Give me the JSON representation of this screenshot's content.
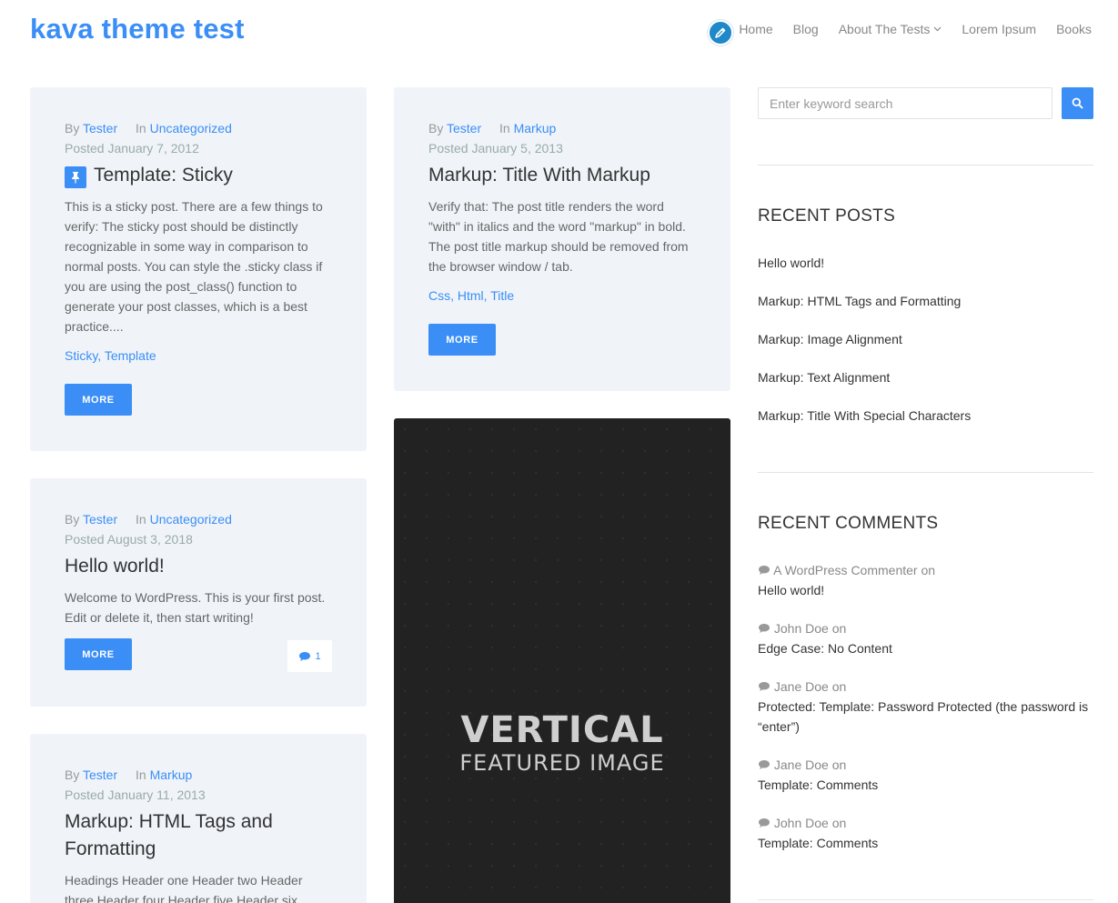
{
  "site": {
    "title": "kava theme test"
  },
  "nav": {
    "items": [
      "Home",
      "Blog",
      "About The Tests",
      "Lorem Ipsum",
      "Books"
    ]
  },
  "posts": [
    {
      "by_label": "By",
      "author": "Tester",
      "in_label": "In",
      "category": "Uncategorized",
      "date": "Posted January 7, 2012",
      "title": "Template: Sticky",
      "excerpt": "This is a sticky post. There are a few things to verify: The sticky post should be distinctly recognizable in some way in comparison to normal posts. You can style the .sticky class if you are using the post_class() function to generate your post classes, which is a best practice....",
      "tags": "Sticky, Template",
      "more": "MORE"
    },
    {
      "by_label": "By",
      "author": "Tester",
      "in_label": "In",
      "category": "Markup",
      "date": "Posted January 5, 2013",
      "title": "Markup: Title With Markup",
      "excerpt": "Verify that: The post title renders the word \"with\" in italics and the word \"markup\" in bold. The post title markup should be removed from the browser window / tab.",
      "tags": "Css, Html, Title",
      "more": "MORE"
    },
    {
      "by_label": "By",
      "author": "Tester",
      "in_label": "In",
      "category": "Uncategorized",
      "date": "Posted August 3, 2018",
      "title": "Hello world!",
      "excerpt": "Welcome to WordPress. This is your first post. Edit or delete it, then start writing!",
      "more": "MORE",
      "comments": "1"
    },
    {
      "by_label": "By",
      "author": "Tester",
      "in_label": "In",
      "category": "Markup",
      "date": "Posted January 11, 2013",
      "title": "Markup: HTML Tags and Formatting",
      "excerpt": "Headings Header one Header two Header three Header four Header five Header six Blockquotes"
    }
  ],
  "featured_image": {
    "title": "VERTICAL",
    "subtitle": "FEATURED IMAGE"
  },
  "sidebar": {
    "search_placeholder": "Enter keyword search",
    "recent_posts": {
      "title": "RECENT POSTS",
      "items": [
        "Hello world!",
        "Markup: HTML Tags and Formatting",
        "Markup: Image Alignment",
        "Markup: Text Alignment",
        "Markup: Title With Special Characters"
      ]
    },
    "recent_comments": {
      "title": "RECENT COMMENTS",
      "on": "on",
      "items": [
        {
          "author": "A WordPress Commenter",
          "post": "Hello world!"
        },
        {
          "author": "John Doe",
          "post": "Edge Case: No Content"
        },
        {
          "author": "Jane Doe",
          "post": "Protected: Template: Password Protected (the password is “enter”)"
        },
        {
          "author": "Jane Doe",
          "post": "Template: Comments"
        },
        {
          "author": "John Doe",
          "post": "Template: Comments"
        }
      ]
    }
  },
  "colors": {
    "accent": "#3a8ef6",
    "card_bg": "#f0f4f9",
    "edit_button": "#1e88c9"
  }
}
